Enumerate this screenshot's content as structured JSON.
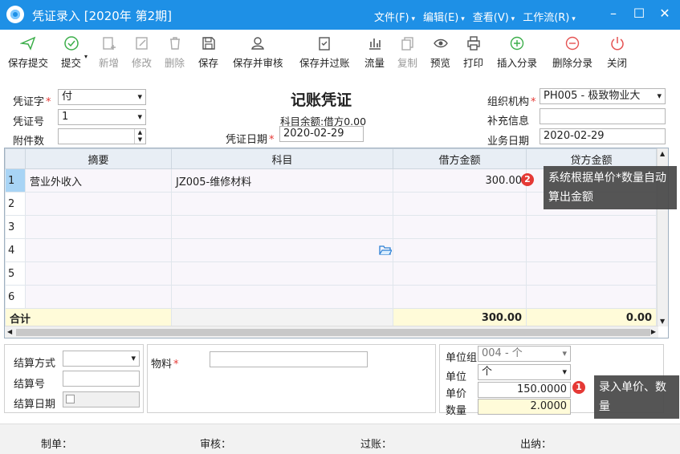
{
  "window": {
    "title": "凭证录入 [2020年 第2期]"
  },
  "menu": [
    "文件(F)",
    "编辑(E)",
    "查看(V)",
    "工作流(R)"
  ],
  "toolbar": [
    {
      "label": "保存提交",
      "icon": "send-icon",
      "enabled": true
    },
    {
      "label": "提交",
      "icon": "check-circle-icon",
      "enabled": true
    },
    {
      "label": "新增",
      "icon": "add-doc-icon",
      "enabled": false
    },
    {
      "label": "修改",
      "icon": "edit-icon",
      "enabled": false
    },
    {
      "label": "删除",
      "icon": "trash-icon",
      "enabled": false
    },
    {
      "label": "保存",
      "icon": "save-icon",
      "enabled": true
    },
    {
      "label": "保存并审核",
      "icon": "user-check-icon",
      "enabled": true
    },
    {
      "label": "保存并过账",
      "icon": "clipboard-check-icon",
      "enabled": true
    },
    {
      "label": "流量",
      "icon": "bar-chart-icon",
      "enabled": true
    },
    {
      "label": "复制",
      "icon": "copy-icon",
      "enabled": false
    },
    {
      "label": "预览",
      "icon": "eye-icon",
      "enabled": true
    },
    {
      "label": "打印",
      "icon": "printer-icon",
      "enabled": true
    },
    {
      "label": "插入分录",
      "icon": "plus-circle-icon",
      "enabled": true
    },
    {
      "label": "删除分录",
      "icon": "minus-circle-icon",
      "enabled": true
    },
    {
      "label": "关闭",
      "icon": "power-icon",
      "enabled": true
    }
  ],
  "header": {
    "voucher_word_label": "凭证字",
    "voucher_word_value": "付",
    "voucher_no_label": "凭证号",
    "voucher_no_value": "1",
    "attachments_label": "附件数",
    "attachments_value": "",
    "title": "记账凭证",
    "balance": "科目余额:借方0.00",
    "date_label": "凭证日期",
    "date_value": "2020-02-29",
    "org_label": "组织机构",
    "org_value": "PH005 - 极致物业大",
    "extra_label": "补充信息",
    "extra_value": "",
    "biz_date_label": "业务日期",
    "biz_date_value": "2020-02-29"
  },
  "grid": {
    "columns": [
      "摘要",
      "科目",
      "借方金额",
      "贷方金额"
    ],
    "rows": [
      {
        "no": "1",
        "summary": "营业外收入",
        "account": "JZ005-维修材料",
        "debit": "300.00",
        "credit": ""
      },
      {
        "no": "2",
        "summary": "",
        "account": "",
        "debit": "",
        "credit": ""
      },
      {
        "no": "3",
        "summary": "",
        "account": "",
        "debit": "",
        "credit": ""
      },
      {
        "no": "4",
        "summary": "",
        "account": "",
        "debit": "",
        "credit": ""
      },
      {
        "no": "5",
        "summary": "",
        "account": "",
        "debit": "",
        "credit": ""
      },
      {
        "no": "6",
        "summary": "",
        "account": "",
        "debit": "",
        "credit": ""
      }
    ],
    "total_label": "合计",
    "total_debit": "300.00",
    "total_credit": "0.00"
  },
  "bottom": {
    "settle_method_label": "结算方式",
    "settle_method_value": "",
    "settle_no_label": "结算号",
    "settle_no_value": "",
    "settle_date_label": "结算日期",
    "material_label": "物料",
    "material_value": "",
    "unit_group_label": "单位组",
    "unit_group_value": "004 - 个",
    "unit_label": "单位",
    "unit_value": "个",
    "price_label": "单价",
    "price_value": "150.0000",
    "qty_label": "数量",
    "qty_value": "2.0000"
  },
  "footer": {
    "maker": "制单：",
    "auditor": "审核：",
    "poster": "过账：",
    "cashier": "出纳："
  },
  "tips": {
    "tip1_badge": "1",
    "tip1_text": "录入单价、数量",
    "tip2_badge": "2",
    "tip2_text": "系统根据单价*数量自动算出金额"
  }
}
